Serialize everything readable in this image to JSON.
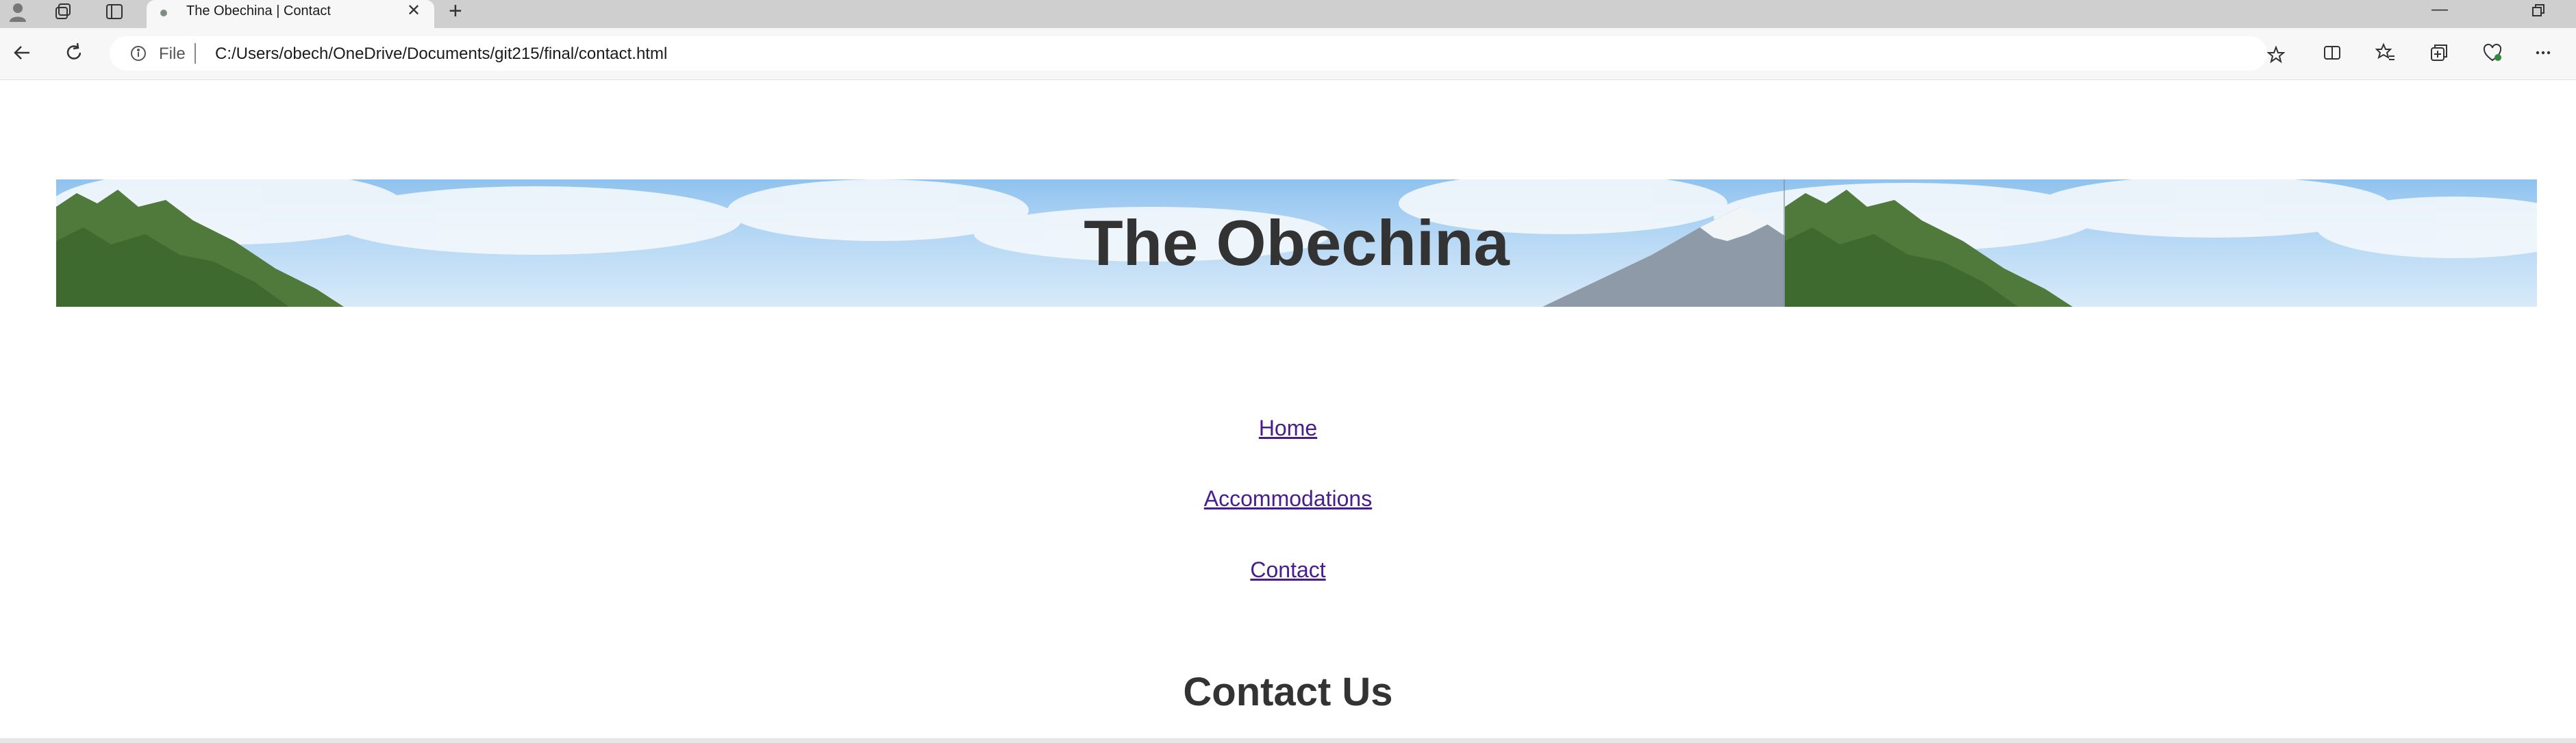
{
  "browser": {
    "tab_title": "The Obechina | Contact",
    "address_scheme_label": "File",
    "address_url": "C:/Users/obech/OneDrive/Documents/git215/final/contact.html"
  },
  "page": {
    "site_title": "The Obechina",
    "nav": [
      "Home",
      "Accommodations",
      "Contact"
    ],
    "heading": "Contact Us",
    "link_color": "#4a1d8c",
    "text_color": "#333333"
  }
}
